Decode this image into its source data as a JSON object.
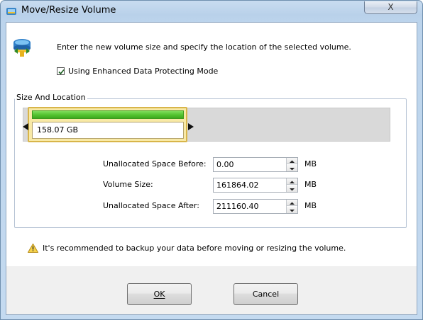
{
  "window": {
    "title": "Move/Resize Volume",
    "close_label": "X"
  },
  "header": {
    "instruction": "Enter the new volume size and specify the location of the selected volume.",
    "checkbox_label": "Using Enhanced Data Protecting Mode",
    "checkbox_checked": true
  },
  "group": {
    "label": "Size And Location",
    "partition_size": "158.07 GB",
    "partition_fill_fraction": 0.43
  },
  "fields": [
    {
      "label": "Unallocated Space Before:",
      "value": "0.00",
      "unit": "MB"
    },
    {
      "label": "Volume Size:",
      "value": "161864.02",
      "unit": "MB"
    },
    {
      "label": "Unallocated Space After:",
      "value": "211160.40",
      "unit": "MB"
    }
  ],
  "warning": "It's recommended to backup your data before moving or resizing the volume.",
  "buttons": {
    "ok": "OK",
    "cancel": "Cancel"
  },
  "icons": [
    "app-icon",
    "move-resize-icon",
    "checkmark-icon",
    "left-handle-icon",
    "right-handle-icon",
    "spin-up-icon",
    "spin-down-icon",
    "warning-icon"
  ],
  "colors": {
    "partition_bar": "#4fbf2b",
    "partition_border": "#d8b54a",
    "title_bar": "#b9d1ea"
  }
}
